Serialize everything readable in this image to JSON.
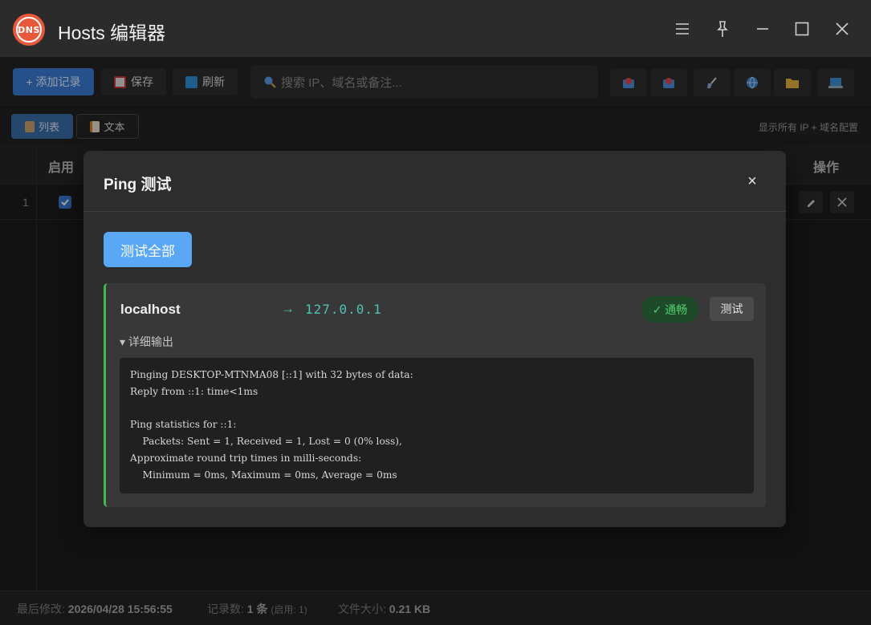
{
  "app": {
    "logo_text": "DNS",
    "title": "Hosts 编辑器"
  },
  "toolbar": {
    "add_label": "+ 添加记录",
    "save_label": "保存",
    "refresh_label": "刷新",
    "search_placeholder": "搜索 IP、域名或备注..."
  },
  "view": {
    "list_label": "列表",
    "text_label": "文本",
    "hint": "显示所有 IP + 域名配置"
  },
  "table": {
    "headers": {
      "enabled": "启用",
      "actions": "操作"
    },
    "rows": [
      {
        "num": "1",
        "enabled": true
      }
    ]
  },
  "status": {
    "modified_label": "最后修改:",
    "modified_value": "2026/04/28 15:56:55",
    "count_label": "记录数:",
    "count_value": "1 条",
    "count_extra": "(启用: 1)",
    "size_label": "文件大小:",
    "size_value": "0.21 KB"
  },
  "modal": {
    "title": "Ping 测试",
    "close_glyph": "×",
    "test_all_label": "测试全部",
    "result": {
      "host": "localhost",
      "arrow": "→",
      "ip": "127.0.0.1",
      "status": "✓ 通畅",
      "test_label": "测试",
      "details_label": "▾ 详细输出",
      "output": "Pinging DESKTOP-MTNMA08 [::1] with 32 bytes of data:\nReply from ::1: time<1ms\n\nPing statistics for ::1:\n    Packets: Sent = 1, Received = 1, Lost = 0 (0% loss),\nApproximate round trip times in milli-seconds:\n    Minimum = 0ms, Maximum = 0ms, Average = 0ms"
    }
  },
  "colors": {
    "accent": "#3a7bd5",
    "success": "#3fb950",
    "ip": "#4fc1b4",
    "logo": "#e8583a"
  }
}
